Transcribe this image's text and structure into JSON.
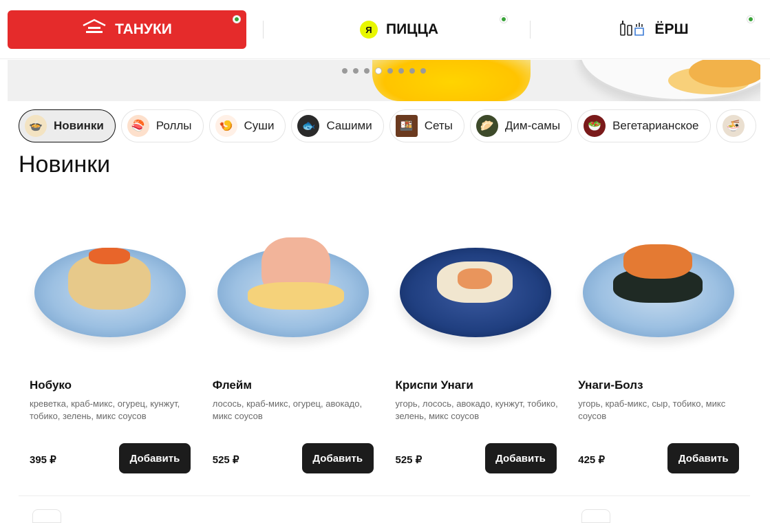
{
  "brands": [
    {
      "label": "ТАНУКИ",
      "icon": "tanuki-roof-icon"
    },
    {
      "label": "ПИЦЦА",
      "icon": "ya-logo-icon",
      "logo_text": "Я"
    },
    {
      "label": "ЁРШ",
      "icon": "bottles-icon"
    }
  ],
  "banner": {
    "slide_count": 8,
    "active_slide": 4
  },
  "categories": [
    {
      "label": "Новинки",
      "icon": "bowl-icon",
      "active": true
    },
    {
      "label": "Роллы",
      "icon": "rolls-icon"
    },
    {
      "label": "Суши",
      "icon": "sushi-icon"
    },
    {
      "label": "Сашими",
      "icon": "sashimi-icon"
    },
    {
      "label": "Сеты",
      "icon": "set-icon"
    },
    {
      "label": "Дим-самы",
      "icon": "dimsum-icon"
    },
    {
      "label": "Вегетарианское",
      "icon": "veggie-icon"
    }
  ],
  "section_title": "Новинки",
  "products": [
    {
      "name": "Нобуко",
      "description": "креветка, краб-микс, огурец, кунжут, тобико, зелень, микс соусов",
      "price": "395 ₽",
      "button": "Добавить"
    },
    {
      "name": "Флейм",
      "description": "лосось, краб-микс, огурец, авокадо, микс соусов",
      "price": "525 ₽",
      "button": "Добавить"
    },
    {
      "name": "Криспи Унаги",
      "description": "угорь, лосось, авокадо, кунжут, тобико, зелень, микс соусов",
      "price": "525 ₽",
      "button": "Добавить"
    },
    {
      "name": "Унаги-Болз",
      "description": "угорь, краб-микс, сыр, тобико, микс соусов",
      "price": "425 ₽",
      "button": "Добавить"
    }
  ],
  "colors": {
    "brand_red": "#e52b2b",
    "status_green": "#3aa33a",
    "button_dark": "#1c1c1c"
  }
}
